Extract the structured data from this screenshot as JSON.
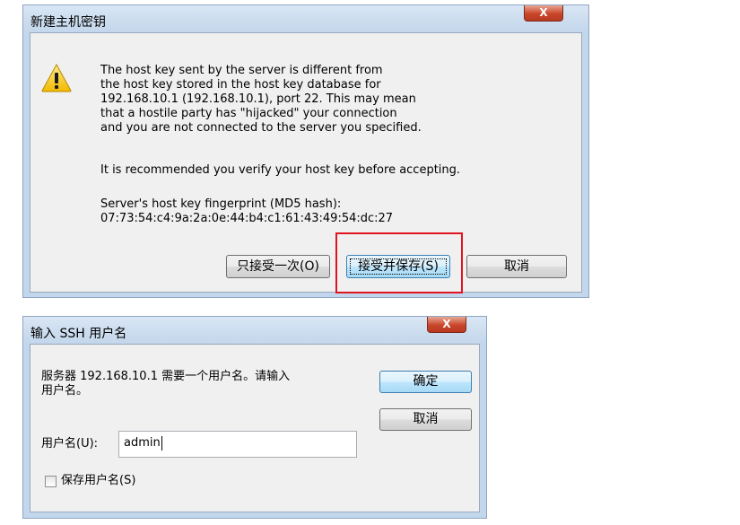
{
  "dialog1": {
    "title": "新建主机密钥",
    "close_label": "X",
    "message_lines": [
      "The host key sent by the server is different from",
      "the host key stored in the host key database for",
      "192.168.10.1 (192.168.10.1), port 22.  This may mean",
      "that a hostile party has \"hijacked\" your connection",
      "and you are not connected to the server you specified."
    ],
    "recommend": "It is recommended you verify your host key before accepting.",
    "fingerprint_label": "Server's host key fingerprint (MD5 hash):",
    "fingerprint_value": "07:73:54:c4:9a:2a:0e:44:b4:c1:61:43:49:54:dc:27",
    "btn_accept_once": "只接受一次(O)",
    "btn_accept_save": "接受并保存(S)",
    "btn_cancel": "取消",
    "highlight_color": "#e0141e"
  },
  "dialog2": {
    "title": "输入 SSH 用户名",
    "close_label": "X",
    "prompt_line1": "服务器 192.168.10.1 需要一个用户名。请输入",
    "prompt_line2": "用户名。",
    "btn_ok": "确定",
    "btn_cancel": "取消",
    "username_label": "用户名(U):",
    "username_value": "admin",
    "save_username_label": "保存用户名(S)",
    "save_username_checked": false
  },
  "icons": {
    "warning": "warning-icon",
    "close": "close-icon"
  }
}
